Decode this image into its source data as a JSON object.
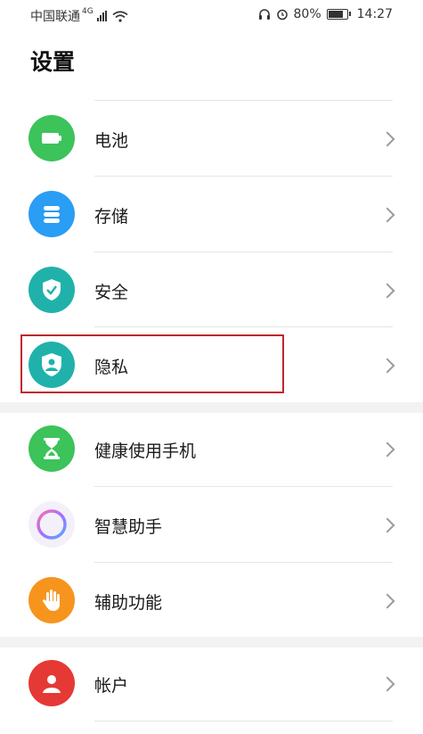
{
  "status_bar": {
    "carrier": "中国联通",
    "network": "4G",
    "battery": "80%",
    "time": "14:27"
  },
  "page": {
    "title": "设置"
  },
  "settings": [
    {
      "label": "电池",
      "icon": "battery-icon",
      "color": "#3cc35a"
    },
    {
      "label": "存储",
      "icon": "storage-icon",
      "color": "#2a9df4"
    },
    {
      "label": "安全",
      "icon": "shield-check-icon",
      "color": "#20b2aa"
    },
    {
      "label": "隐私",
      "icon": "privacy-icon",
      "color": "#20b2aa"
    },
    {
      "label": "健康使用手机",
      "icon": "hourglass-icon",
      "color": "#3cc35a"
    },
    {
      "label": "智慧助手",
      "icon": "assistant-ring-icon",
      "color": "#a070ff"
    },
    {
      "label": "辅助功能",
      "icon": "hand-icon",
      "color": "#f7941d"
    },
    {
      "label": "帐户",
      "icon": "account-icon",
      "color": "#e53935"
    }
  ]
}
